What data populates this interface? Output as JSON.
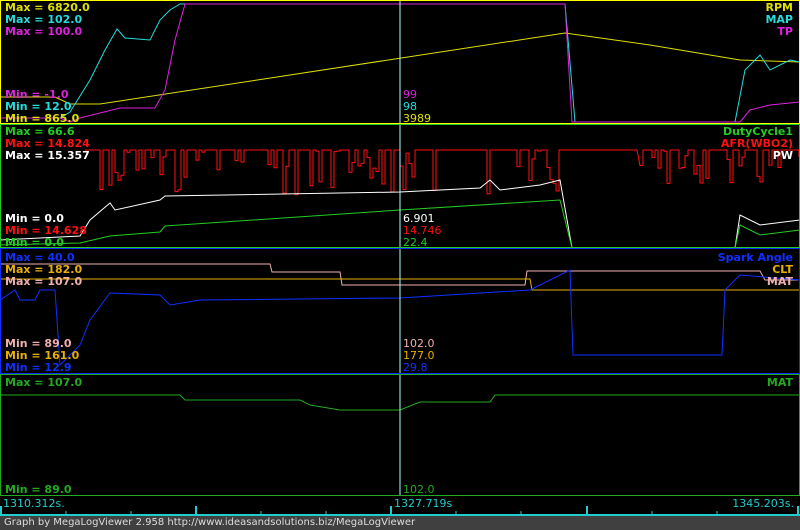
{
  "colors": {
    "rpm": "#e0e000",
    "map": "#22dddd",
    "tp": "#dd22dd",
    "duty": "#22cc22",
    "afr": "#ff1010",
    "pw": "#ffffff",
    "spark": "#1030ff",
    "clt": "#e8b000",
    "mat": "#f0b0b0",
    "mat2": "#22aa22",
    "cursor": "#aaffff"
  },
  "panels": [
    {
      "border": "#ffff00",
      "channels": [
        {
          "name": "RPM",
          "max": "Max = 6820.0",
          "min": "Min = 865.0",
          "cursor": "3989"
        },
        {
          "name": "MAP",
          "max": "Max = 102.0",
          "min": "Min = 12.0",
          "cursor": "98"
        },
        {
          "name": "TP",
          "max": "Max = 100.0",
          "min": "Min = -1.0",
          "cursor": "99"
        }
      ]
    },
    {
      "border": "#22cc22",
      "channels": [
        {
          "name": "DutyCycle1",
          "max": "Max = 66.6",
          "min": "Min = 0.0",
          "cursor": "22.4"
        },
        {
          "name": "AFR(WBO2)",
          "max": "Max = 14.824",
          "min": "Min = 14.628",
          "cursor": "14.746"
        },
        {
          "name": "PW",
          "max": "Max = 15.357",
          "min": "Min = 0.0",
          "cursor": "6.901"
        }
      ]
    },
    {
      "border": "#1030ff",
      "channels": [
        {
          "name": "Spark Angle",
          "max": "Max = 40.0",
          "min": "Min = 12.9",
          "cursor": "29.8"
        },
        {
          "name": "CLT",
          "max": "Max = 182.0",
          "min": "Min = 161.0",
          "cursor": "177.0"
        },
        {
          "name": "MAT",
          "max": "Max = 107.0",
          "min": "Min = 89.0",
          "cursor": "102.0"
        }
      ]
    },
    {
      "border": "#22aa22",
      "channels": [
        {
          "name": "MAT",
          "max": "Max = 107.0",
          "min": "Min = 89.0",
          "cursor": "102.0"
        }
      ]
    }
  ],
  "time_axis": {
    "start": "1310.312s.",
    "cursor": "1327.719s",
    "end": "1345.203s."
  },
  "footer": "Graph by MegaLogViewer 2.958 http://www.ideasandsolutions.biz/MegaLogViewer"
}
